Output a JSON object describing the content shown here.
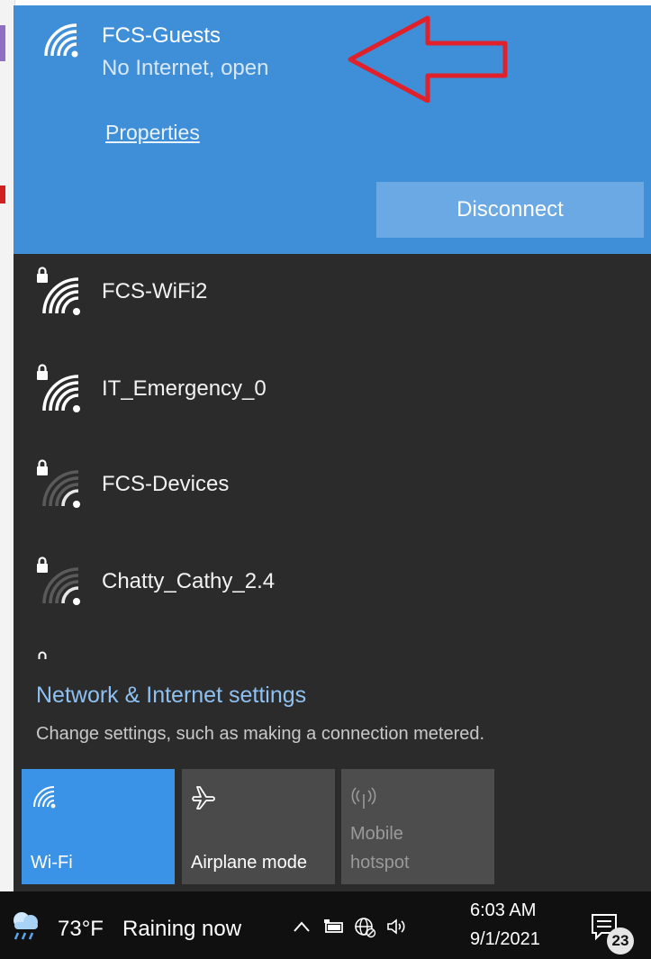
{
  "connected_network": {
    "name": "FCS-Guests",
    "status": "No Internet, open",
    "properties_link": "Properties",
    "disconnect_label": "Disconnect",
    "icon": "wifi-icon"
  },
  "networks": [
    {
      "name": "FCS-WiFi2",
      "secured": true,
      "icon": "wifi-secured-icon",
      "signal": "strong"
    },
    {
      "name": "IT_Emergency_0",
      "secured": true,
      "icon": "wifi-secured-icon",
      "signal": "strong"
    },
    {
      "name": "FCS-Devices",
      "secured": true,
      "icon": "wifi-secured-icon",
      "signal": "weak"
    },
    {
      "name": "Chatty_Cathy_2.4",
      "secured": true,
      "icon": "wifi-secured-icon",
      "signal": "weak"
    }
  ],
  "settings": {
    "link_label": "Network & Internet settings",
    "description": "Change settings, such as making a connection metered."
  },
  "quick_actions": [
    {
      "label": "Wi-Fi",
      "active": true,
      "icon": "wifi-icon"
    },
    {
      "label": "Airplane mode",
      "active": false,
      "icon": "airplane-icon"
    },
    {
      "label": "Mobile\nhotspot",
      "active": false,
      "disabled": true,
      "icon": "hotspot-icon"
    }
  ],
  "taskbar": {
    "weather_temp": "73°F",
    "weather_desc": "Raining now",
    "time": "6:03 AM",
    "date": "9/1/2021",
    "notification_count": "23"
  },
  "colors": {
    "connected_bg": "#3f8fd8",
    "flyout_bg": "#2b2b2b",
    "accent_link": "#8ec1f2",
    "wifi_tile_active": "#3b93e8",
    "annotation_arrow": "#e0202a"
  }
}
